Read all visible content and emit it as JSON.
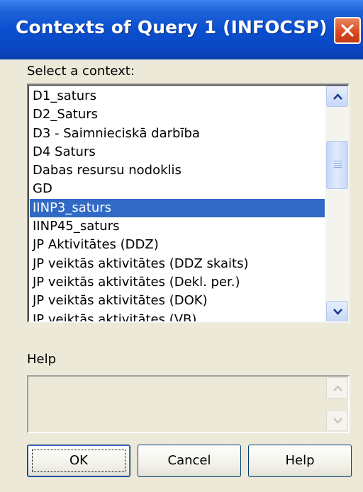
{
  "window": {
    "title": "Contexts of Query 1 (INFOCSP)",
    "close_icon": "close-icon"
  },
  "context_list": {
    "label": "Select a context:",
    "items": [
      "D1_saturs",
      "D2_Saturs",
      "D3 - Saimnieciskā darbība",
      "D4 Saturs",
      "Dabas resursu nodoklis",
      "GD",
      "IINP3_saturs",
      "IINP45_saturs",
      "JP Aktivitātes (DDZ)",
      "JP veiktās aktivitātes (DDZ skaits)",
      "JP veiktās aktivitātes (Dekl. per.)",
      "JP veiktās aktivitātes (DOK)",
      "JP veiktās aktivitātes (VB)"
    ],
    "selected": "IINP3_saturs"
  },
  "help_section": {
    "label": "Help",
    "text": ""
  },
  "buttons": {
    "ok": "OK",
    "cancel": "Cancel",
    "help": "Help"
  },
  "colors": {
    "title_bar": "#0a4fd0",
    "selection": "#316ac5",
    "dialog_bg": "#ece9d8",
    "close_button": "#d9461e"
  }
}
